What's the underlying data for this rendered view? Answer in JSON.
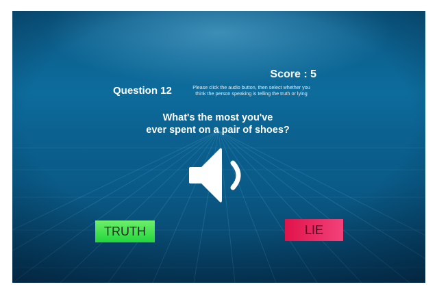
{
  "game": {
    "score_text": "Score : 5",
    "question_label": "Question 12",
    "instructions_line1": "Please click the audio button, then select whether you",
    "instructions_line2": "think the person speaking is telling the truth or lying",
    "prompt_line1": "What's the most you've",
    "prompt_line2": "ever spent on a pair of shoes?",
    "audio_icon": "speaker-icon",
    "truth_label": "TRUTH",
    "lie_label": "LIE"
  },
  "colors": {
    "truth_button": "#33e04a",
    "lie_button": "#ea2d63",
    "background": "#0d6c9c",
    "text": "#ffffff"
  }
}
